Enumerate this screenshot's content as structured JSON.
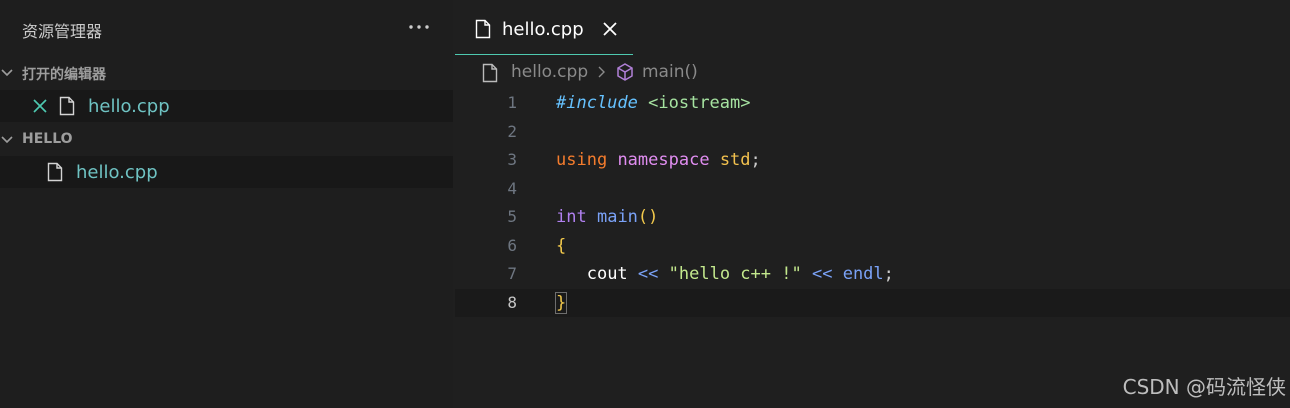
{
  "sidebar": {
    "title": "资源管理器",
    "more_icon": "ellipsis-icon",
    "open_editors": {
      "title": "打开的编辑器",
      "items": [
        {
          "name": "hello.cpp"
        }
      ]
    },
    "folder": {
      "title": "HELLO",
      "items": [
        {
          "name": "hello.cpp"
        }
      ]
    }
  },
  "editor": {
    "tab": {
      "label": "hello.cpp"
    },
    "breadcrumb": {
      "file": "hello.cpp",
      "symbol": "main()"
    },
    "current_line": 8,
    "lines": [
      {
        "num": "1",
        "tokens": [
          [
            "kw-include",
            "#include"
          ],
          [
            "punc",
            " "
          ],
          [
            "lib",
            "<iostream>"
          ]
        ]
      },
      {
        "num": "2",
        "tokens": []
      },
      {
        "num": "3",
        "tokens": [
          [
            "kw",
            "using"
          ],
          [
            "punc",
            " "
          ],
          [
            "ns",
            "namespace"
          ],
          [
            "punc",
            " "
          ],
          [
            "std",
            "std"
          ],
          [
            "punc",
            ";"
          ]
        ]
      },
      {
        "num": "4",
        "tokens": []
      },
      {
        "num": "5",
        "tokens": [
          [
            "type",
            "int"
          ],
          [
            "punc",
            " "
          ],
          [
            "fn",
            "main"
          ],
          [
            "paren",
            "()"
          ]
        ]
      },
      {
        "num": "6",
        "tokens": [
          [
            "brace",
            "{"
          ]
        ]
      },
      {
        "num": "7",
        "tokens": [
          [
            "punc",
            "   "
          ],
          [
            "ident",
            "cout"
          ],
          [
            "punc",
            " "
          ],
          [
            "op",
            "<<"
          ],
          [
            "punc",
            " "
          ],
          [
            "str",
            "\"hello c++ !\""
          ],
          [
            "punc",
            " "
          ],
          [
            "op",
            "<<"
          ],
          [
            "punc",
            " "
          ],
          [
            "endl",
            "endl"
          ],
          [
            "punc",
            ";"
          ]
        ]
      },
      {
        "num": "8",
        "tokens": [
          [
            "brace brace-box",
            "}"
          ]
        ]
      }
    ]
  },
  "watermark": "CSDN @码流怪侠",
  "colors": {
    "background": "#1f1f1f",
    "accent": "#4ec9b0",
    "filename": "#6fc3c3"
  }
}
